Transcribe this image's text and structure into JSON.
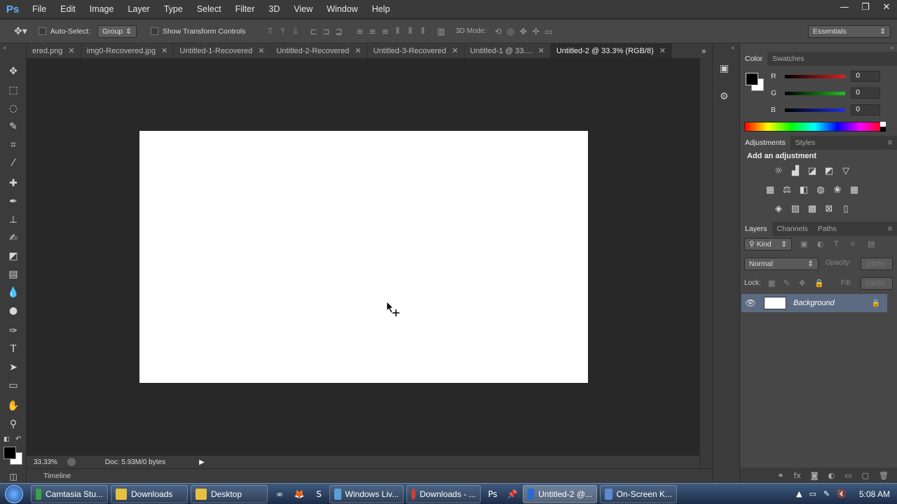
{
  "app": {
    "logo": "Ps"
  },
  "menu": [
    "File",
    "Edit",
    "Image",
    "Layer",
    "Type",
    "Select",
    "Filter",
    "3D",
    "View",
    "Window",
    "Help"
  ],
  "window_controls": {
    "minimize": "—",
    "restore": "❐",
    "close": "✕"
  },
  "options": {
    "auto_select_label": "Auto-Select:",
    "auto_select_mode": "Group",
    "transform_controls_label": "Show Transform Controls",
    "mode_3d_label": "3D Mode:",
    "workspace": "Essentials"
  },
  "tabs": [
    {
      "label": "ered.png",
      "active": false
    },
    {
      "label": "img0-Recovered.jpg",
      "active": false
    },
    {
      "label": "Untitled-1-Recovered",
      "active": false
    },
    {
      "label": "Untitled-2-Recovered",
      "active": false
    },
    {
      "label": "Untitled-3-Recovered",
      "active": false
    },
    {
      "label": "Untitled-1 @ 33....",
      "active": false
    },
    {
      "label": "Untitled-2 @ 33.3% (RGB/8)",
      "active": true
    }
  ],
  "status": {
    "zoom": "33.33%",
    "doc": "Doc: 5.93M/0 bytes"
  },
  "timeline_label": "Timeline",
  "color_panel": {
    "tabs": [
      "Color",
      "Swatches"
    ],
    "channels": [
      {
        "label": "R",
        "value": "0",
        "color": "#e02020"
      },
      {
        "label": "G",
        "value": "0",
        "color": "#20c020"
      },
      {
        "label": "B",
        "value": "0",
        "color": "#2030e0"
      }
    ]
  },
  "adjustments_panel": {
    "tabs": [
      "Adjustments",
      "Styles"
    ],
    "heading": "Add an adjustment"
  },
  "layers_panel": {
    "tabs": [
      "Layers",
      "Channels",
      "Paths"
    ],
    "filter_kind": "Kind",
    "blend_mode": "Normal",
    "opacity_label": "Opacity:",
    "opacity_value": "100%",
    "lock_label": "Lock:",
    "fill_label": "Fill:",
    "fill_value": "100%",
    "layers": [
      {
        "name": "Background",
        "visible": true,
        "locked": true
      }
    ]
  },
  "taskbar": {
    "items": [
      {
        "label": "Camtasia Stu...",
        "color": "#3aa04a",
        "active": false
      },
      {
        "label": "Downloads",
        "color": "#e8c040",
        "active": false
      },
      {
        "label": "Desktop",
        "color": "#e8c040",
        "active": false
      },
      {
        "label": "Windows Liv...",
        "color": "#5aa0d8",
        "active": false
      },
      {
        "label": "Downloads - ...",
        "color": "#d04030",
        "active": false
      },
      {
        "label": "Untitled-2 @...",
        "color": "#2a6ad0",
        "active": true
      },
      {
        "label": "On-Screen K...",
        "color": "#5a8ad0",
        "active": false
      }
    ],
    "clock": "5:08 AM"
  }
}
